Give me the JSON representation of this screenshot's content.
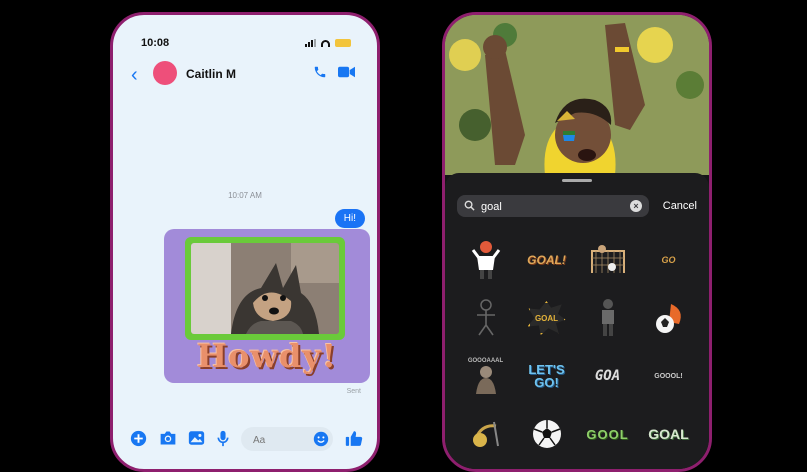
{
  "left_phone": {
    "status": {
      "time": "10:08"
    },
    "header": {
      "contact_name": "Caitlin M"
    },
    "conversation": {
      "timestamp": "10:07 AM",
      "outgoing_message": "Hi!",
      "sticker_text": "Howdy!",
      "sent_status": "Sent"
    },
    "composer": {
      "placeholder": "Aa"
    }
  },
  "right_phone": {
    "search": {
      "query": "goal",
      "cancel_label": "Cancel"
    },
    "stickers": [
      {
        "text": ""
      },
      {
        "text": "GOAL!"
      },
      {
        "text": ""
      },
      {
        "text": "GO"
      },
      {
        "text": ""
      },
      {
        "text": "GOAL"
      },
      {
        "text": ""
      },
      {
        "text": ""
      },
      {
        "text": "GOOOAAAL"
      },
      {
        "text": "LET'S GO!"
      },
      {
        "text": "GOA"
      },
      {
        "text": "GOOOL!"
      },
      {
        "text": ""
      },
      {
        "text": ""
      },
      {
        "text": "GOOL"
      },
      {
        "text": "GOAL"
      }
    ]
  },
  "colors": {
    "phone_frame": "#8e1f6e",
    "messenger_blue": "#1a73f5",
    "card_purple": "#a28bd9",
    "frame_green": "#6aca3a",
    "howdy_orange": "#e9906b"
  }
}
